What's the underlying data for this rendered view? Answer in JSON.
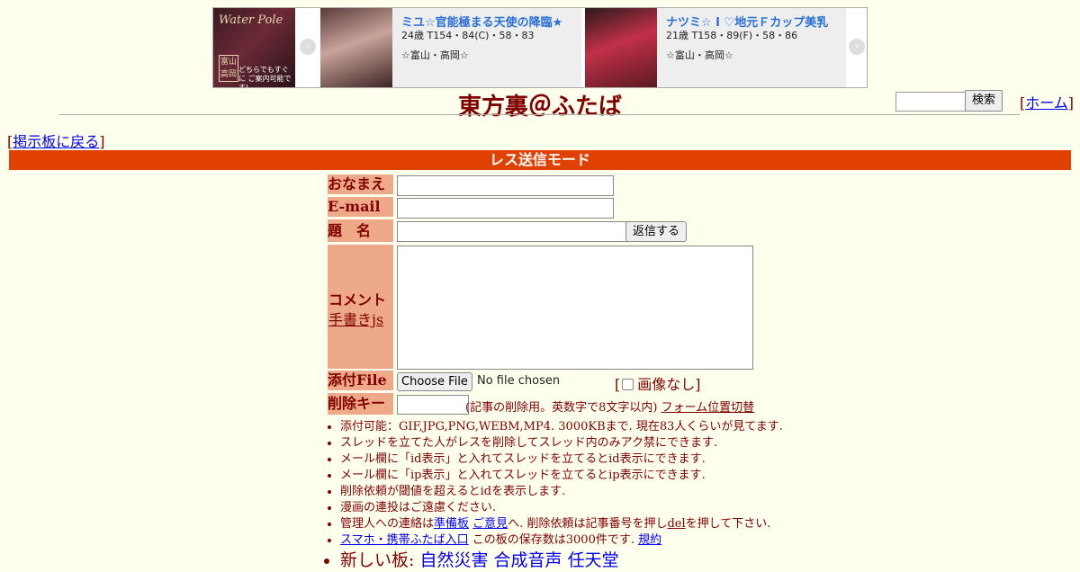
{
  "banner": {
    "side_image": {
      "title": "Water Pole",
      "badge": "富山 高岡",
      "tagline": "どちらでもすぐに ご案内可能です!"
    },
    "cards": [
      {
        "name": "ミユ☆官能極まる天使の降臨★",
        "spec": "24歳 T154・84(C)・58・83",
        "area": "☆富山・高岡☆"
      },
      {
        "name": "ナツミ☆ I ♡地元Ｆカップ美乳",
        "spec": "21歳 T158・89(F)・58・86",
        "area": "☆富山・高岡☆"
      }
    ],
    "prev_arrow": "‹",
    "next_arrow": "›"
  },
  "header": {
    "title": "東方裏＠ふたば",
    "search_label": "検索",
    "home_link": "ホーム"
  },
  "back_link": "掲示板に戻る",
  "mode_title": "レス送信モード",
  "form": {
    "name_label": "おなまえ",
    "email_label": "E-mail",
    "subject_label": "題　名",
    "submit_label": "返信する",
    "comment_label": "コメント",
    "handwrite_link": "手書きjs",
    "file_label": "添付File",
    "file_button": "Choose File",
    "file_status": "No file chosen",
    "no_image_label": "画像なし",
    "delkey_label": "削除キー",
    "delkey_note": "(記事の削除用。英数字で8文字以内)",
    "form_toggle_link": "フォーム位置切替"
  },
  "rules": {
    "items": [
      "添付可能：GIF,JPG,PNG,WEBM,MP4. 3000KBまで. 現在83人くらいが見てます.",
      "スレッドを立てた人がレスを削除してスレッド内のみアク禁にできます.",
      "メール欄に「id表示」と入れてスレッドを立てるとid表示にできます.",
      "メール欄に「ip表示」と入れてスレッドを立てるとip表示にできます.",
      "削除依頼が閾値を超えるとidを表示します.",
      "漫画の連投はご遠慮ください."
    ],
    "contact_pre": "管理人への連絡は",
    "contact_link1": "準備板",
    "contact_link2": "ご意見",
    "contact_mid": "へ. 削除依頼は記事番号を押し",
    "contact_del": "del",
    "contact_post": "を押して下さい.",
    "mobile_link": "スマホ・携帯ふたば入口",
    "mobile_text": " この板の保存数は3000件です.",
    "kiyaku_link": "規約",
    "new_boards_label": "新しい板:",
    "new_boards": [
      "自然災害",
      "合成音声",
      "任天堂"
    ]
  },
  "colors": {
    "background": "#FFFFEE",
    "text": "#800000",
    "label_bg": "#EEAA88",
    "mode_bar": "#E04000",
    "link": "#0000EE"
  }
}
